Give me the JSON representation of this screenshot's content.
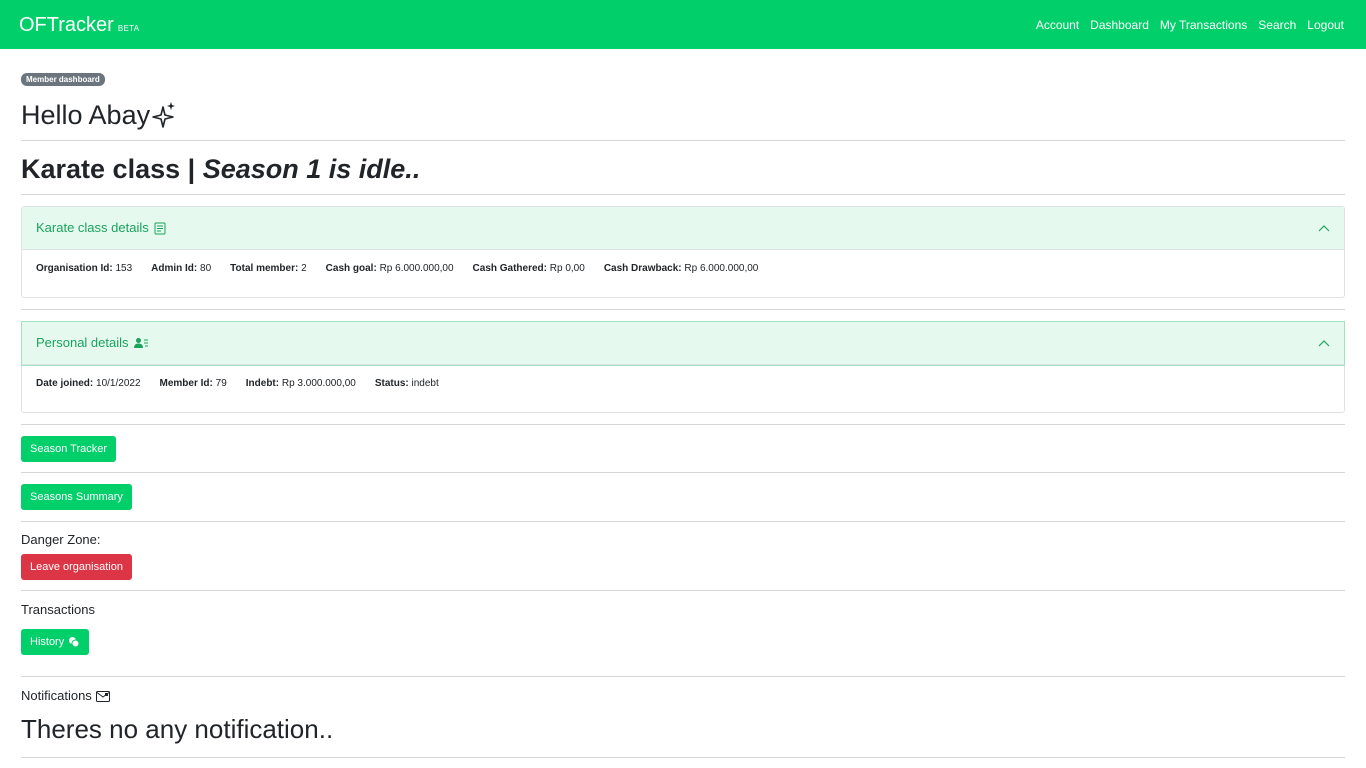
{
  "navbar": {
    "brand": "OFTracker",
    "brand_tag": "BETA",
    "links": [
      "Account",
      "Dashboard",
      "My Transactions",
      "Search",
      "Logout"
    ]
  },
  "header": {
    "badge": "Member dashboard",
    "greeting": "Hello Abay",
    "org_name": "Karate class",
    "separator": "|",
    "season_status": "Season 1 is idle.."
  },
  "org_details": {
    "title": "Karate class details",
    "fields": [
      {
        "label": "Organisation Id:",
        "value": "153"
      },
      {
        "label": "Admin Id:",
        "value": "80"
      },
      {
        "label": "Total member:",
        "value": "2"
      },
      {
        "label": "Cash goal:",
        "value": "Rp 6.000.000,00"
      },
      {
        "label": "Cash Gathered:",
        "value": "Rp 0,00"
      },
      {
        "label": "Cash Drawback:",
        "value": "Rp 6.000.000,00"
      }
    ]
  },
  "personal_details": {
    "title": "Personal details",
    "fields": [
      {
        "label": "Date joined:",
        "value": "10/1/2022"
      },
      {
        "label": "Member Id:",
        "value": "79"
      },
      {
        "label": "Indebt:",
        "value": "Rp 3.000.000,00"
      },
      {
        "label": "Status:",
        "value": "indebt"
      }
    ]
  },
  "buttons": {
    "season_tracker": "Season Tracker",
    "seasons_summary": "Seasons Summary",
    "leave": "Leave organisation",
    "history": "History"
  },
  "sections": {
    "danger_zone": "Danger Zone:",
    "transactions": "Transactions",
    "notifications": "Notifications",
    "empty_notifications": "Theres no any notification.."
  },
  "colors": {
    "primary": "#00cf6a",
    "danger": "#dc3545",
    "accordion_header": "#e6f9ee",
    "accent_text": "#1aa35d"
  }
}
